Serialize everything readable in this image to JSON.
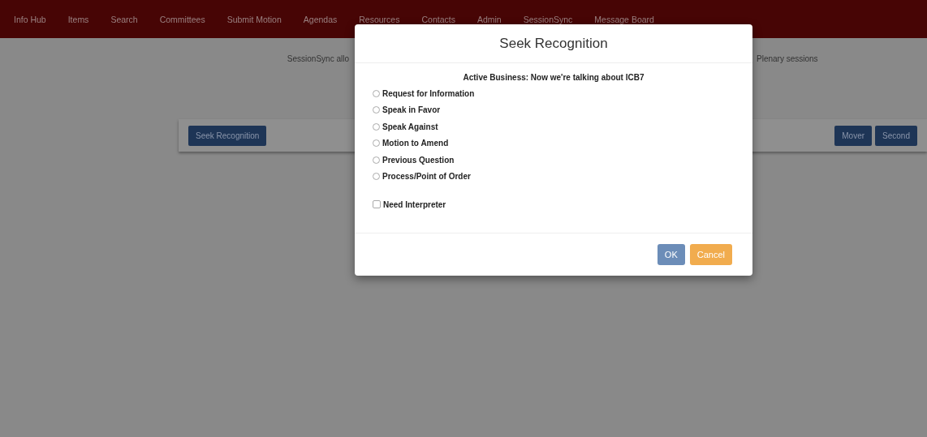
{
  "nav": {
    "items": [
      "Info Hub",
      "Items",
      "Search",
      "Committees",
      "Submit Motion",
      "Agendas",
      "Resources",
      "Contacts",
      "Admin",
      "SessionSync",
      "Message Board"
    ]
  },
  "page": {
    "intro_left": "SessionSync allo",
    "intro_right": "Plenary sessions",
    "toolbar": {
      "left_buttons": [
        "Seek Recognition"
      ],
      "right_buttons": [
        "Mover",
        "Second"
      ]
    }
  },
  "dialog": {
    "title": "Seek Recognition",
    "subtitle": "Active Business: Now we're talking about ICB7",
    "options": [
      {
        "label": "Request for Information",
        "selected": false
      },
      {
        "label": "Speak in Favor",
        "selected": false
      },
      {
        "label": "Speak Against",
        "selected": false
      },
      {
        "label": "Motion to Amend",
        "selected": false
      },
      {
        "label": "Previous Question",
        "selected": false
      },
      {
        "label": "Process/Point of Order",
        "selected": false
      }
    ],
    "interpreter": {
      "label": "Need Interpreter",
      "checked": false
    },
    "buttons": [
      {
        "label": "OK",
        "kind": "primary"
      },
      {
        "label": "Cancel",
        "kind": "warning"
      }
    ]
  }
}
